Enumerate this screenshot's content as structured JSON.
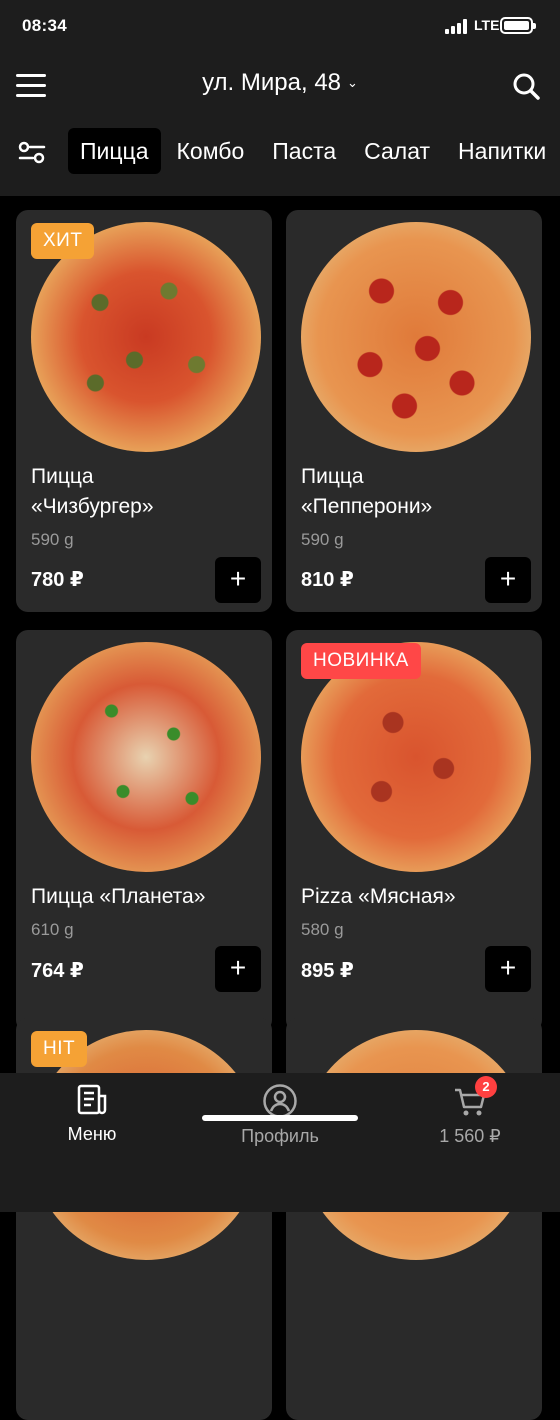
{
  "status": {
    "time": "08:34",
    "network": "LTE"
  },
  "header": {
    "address": "ул. Мира, 48"
  },
  "tabs": [
    "Пицца",
    "Комбо",
    "Паста",
    "Салат",
    "Напитки"
  ],
  "products": [
    {
      "badge": "ХИТ",
      "badge_color": "#f5a235",
      "name": "Пицца\n«Чизбургер»",
      "weight": "590 g",
      "price": "780 ₽"
    },
    {
      "badge": "",
      "name": "Пицца\n«Пепперони»",
      "weight": "590 g",
      "price": "810 ₽"
    },
    {
      "badge": "",
      "name": "Пицца «Планета»",
      "weight": "610 g",
      "price": "764 ₽"
    },
    {
      "badge": "НОВИНКА",
      "badge_color": "#ff4747",
      "name": "Pizza «Мясная»",
      "weight": "580 g",
      "price": "895 ₽"
    },
    {
      "badge": "HIT",
      "badge_color": "#f5a235"
    },
    {
      "badge": ""
    }
  ],
  "add_button_label": "+",
  "bottom_nav": {
    "menu": "Меню",
    "profile": "Профиль",
    "cart": "1 560 ₽",
    "cart_count": "2"
  },
  "colors": {
    "accent_orange": "#f5a235",
    "accent_red": "#ff4747",
    "card_bg": "#2a2a2a",
    "bar_bg": "#1d1d1d"
  }
}
